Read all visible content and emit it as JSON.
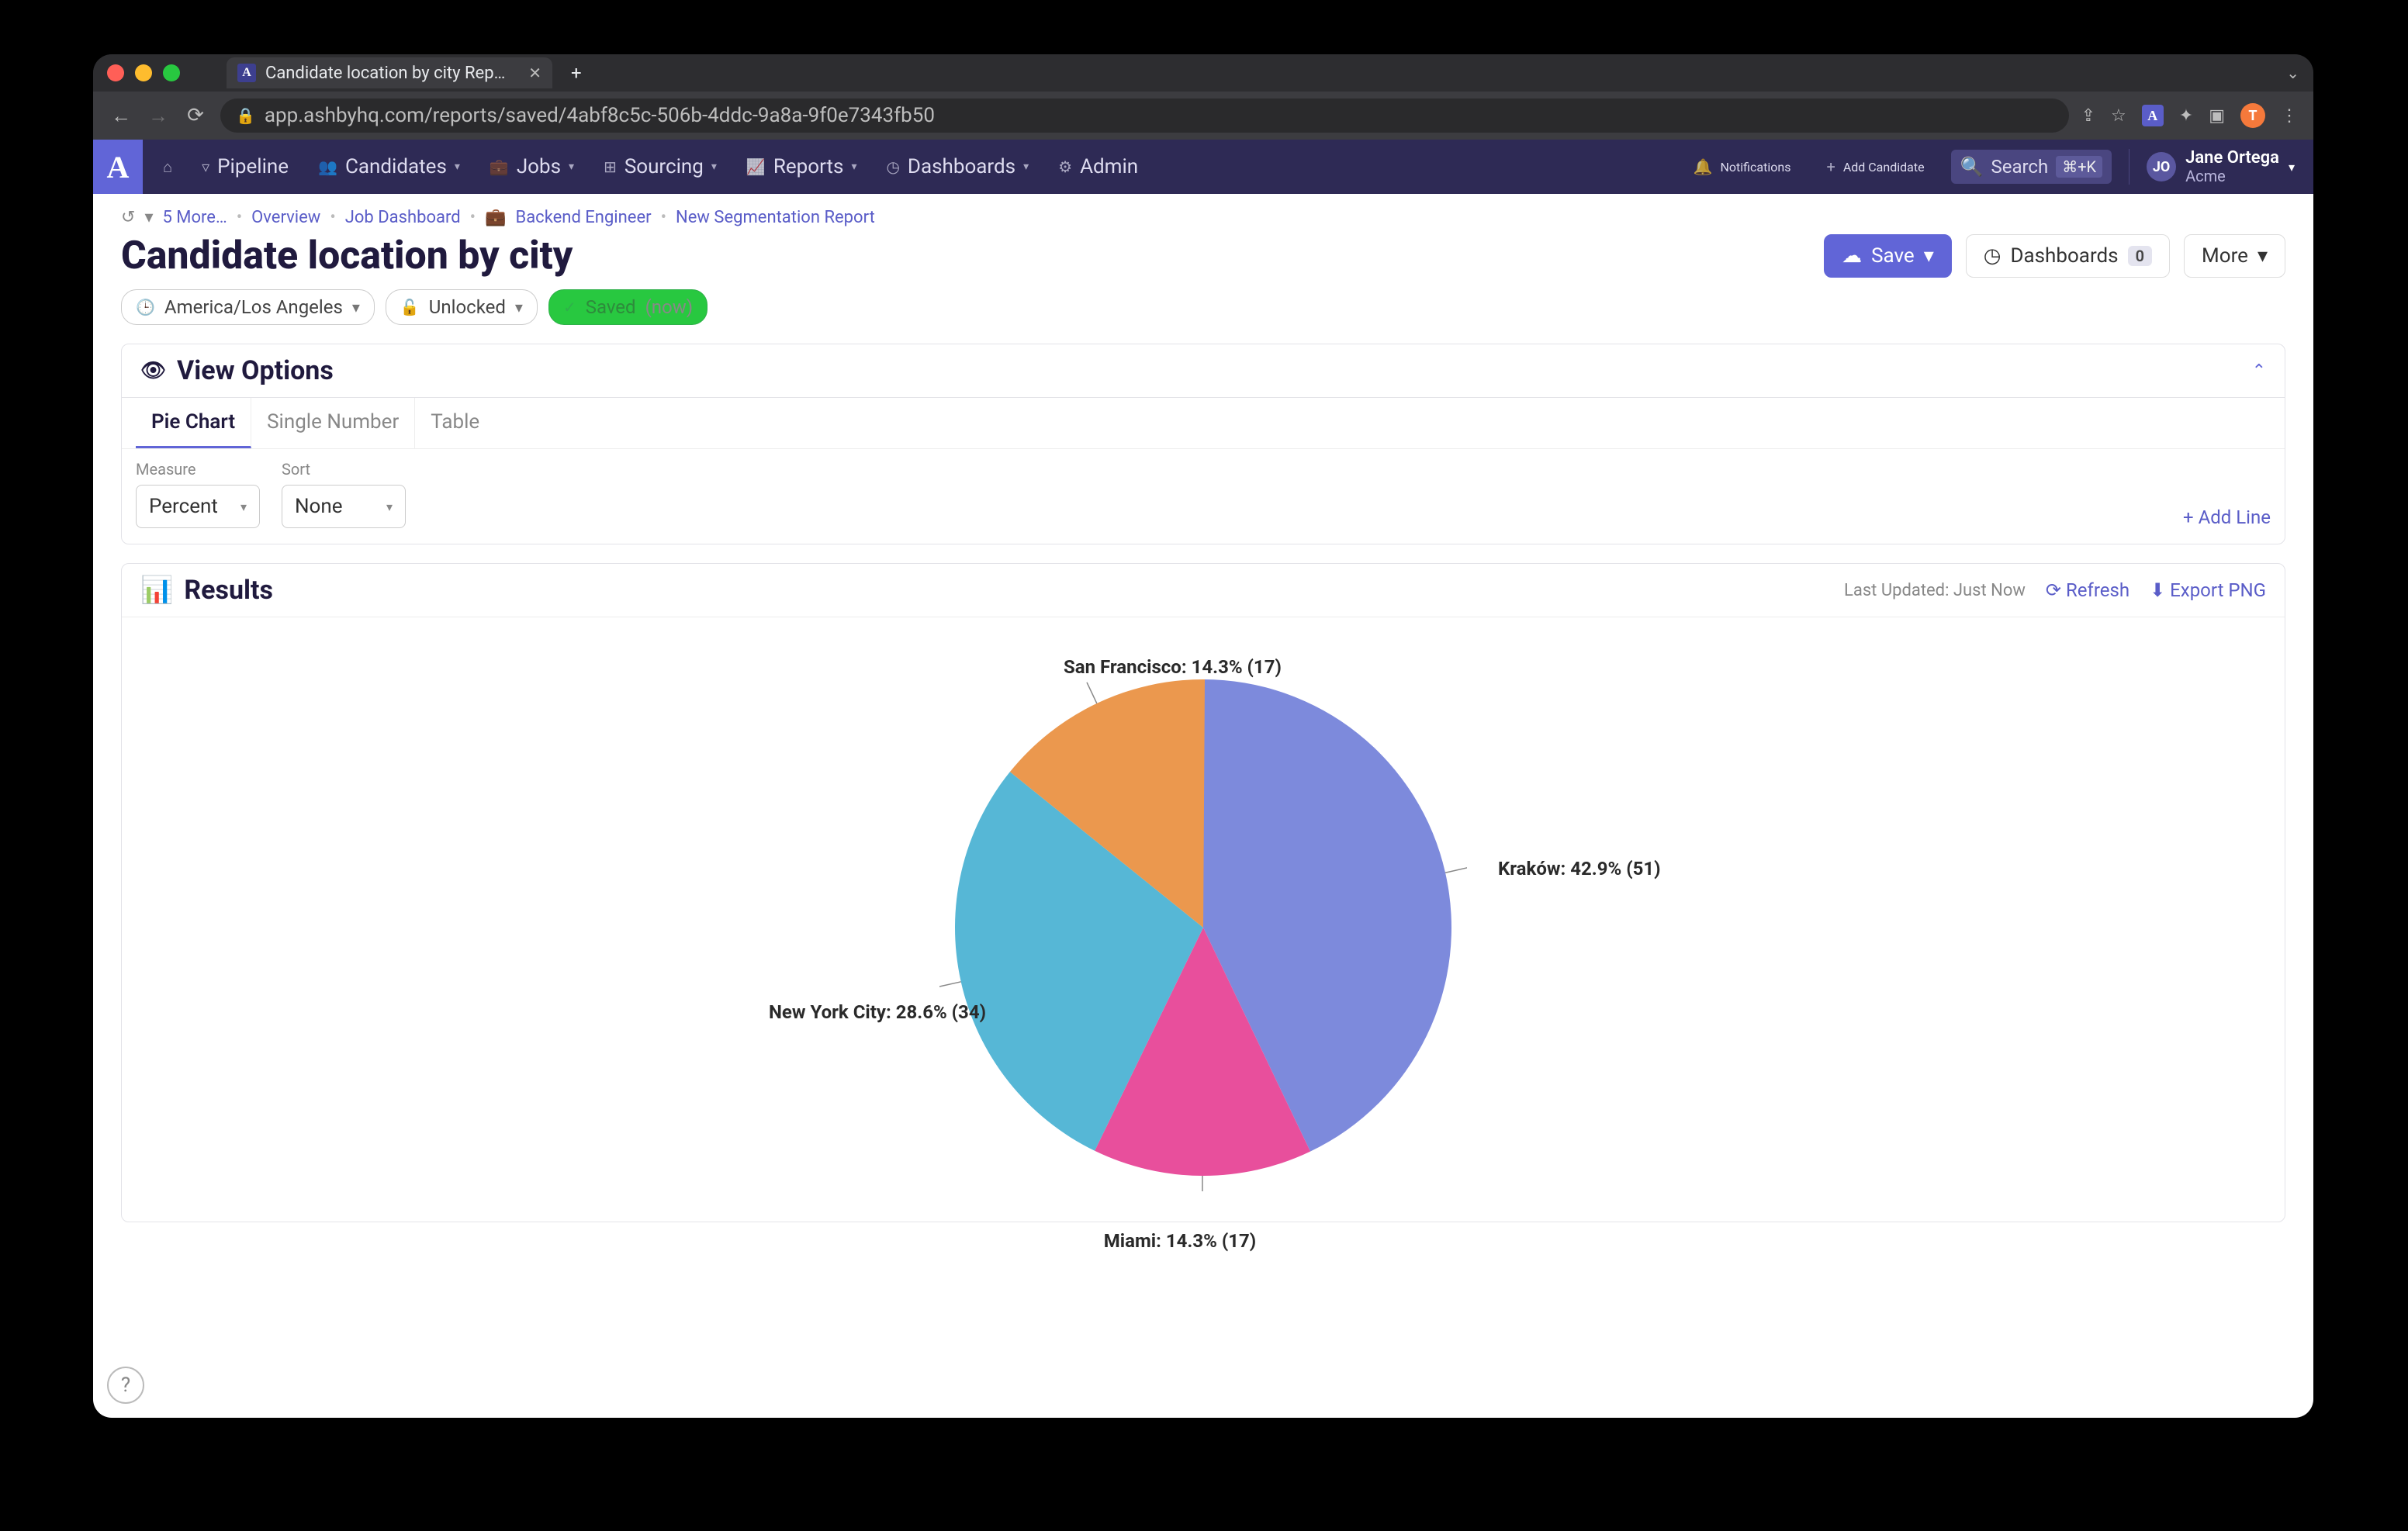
{
  "browser": {
    "tab_title": "Candidate location by city Rep…",
    "url": "app.ashbyhq.com/reports/saved/4abf8c5c-506b-4ddc-9a8a-9f0e7343fb50",
    "profile_initial": "T"
  },
  "topnav": {
    "items": [
      "Pipeline",
      "Candidates",
      "Jobs",
      "Sourcing",
      "Reports",
      "Dashboards",
      "Admin"
    ],
    "notifications": "Notifications",
    "add_candidate": "Add Candidate",
    "search": "Search",
    "search_kbd": "⌘+K",
    "user": {
      "initials": "JO",
      "name": "Jane Ortega",
      "org": "Acme"
    }
  },
  "breadcrumbs": {
    "more": "5 More…",
    "items": [
      "Overview",
      "Job Dashboard",
      "Backend Engineer",
      "New Segmentation Report"
    ]
  },
  "page": {
    "title": "Candidate location by city",
    "save": "Save",
    "dashboards": "Dashboards",
    "dashboards_count": "0",
    "more": "More",
    "chips": {
      "tz": "America/Los Angeles",
      "lock": "Unlocked",
      "saved": "Saved",
      "saved_when": "(now)"
    }
  },
  "view_options": {
    "heading": "View Options",
    "tabs": {
      "pie": "Pie Chart",
      "single": "Single Number",
      "table": "Table"
    },
    "measure_label": "Measure",
    "measure_value": "Percent",
    "sort_label": "Sort",
    "sort_value": "None",
    "add_line": "+ Add Line"
  },
  "results": {
    "heading": "Results",
    "last_updated": "Last Updated: Just Now",
    "refresh": "Refresh",
    "export": "Export PNG"
  },
  "chart_data": {
    "type": "pie",
    "title": "Candidate location by city",
    "series": [
      {
        "name": "Kraków",
        "percent": 42.9,
        "count": 51,
        "color": "#7d8adc",
        "label": "Kraków: 42.9% (51)"
      },
      {
        "name": "Miami",
        "percent": 14.3,
        "count": 17,
        "color": "#e84f9c",
        "label": "Miami: 14.3% (17)"
      },
      {
        "name": "New York City",
        "percent": 28.6,
        "count": 34,
        "color": "#56b7d6",
        "label": "New York City: 28.6% (34)"
      },
      {
        "name": "San Francisco",
        "percent": 14.3,
        "count": 17,
        "color": "#eb984e",
        "label": "San Francisco: 14.3% (17)"
      }
    ]
  }
}
